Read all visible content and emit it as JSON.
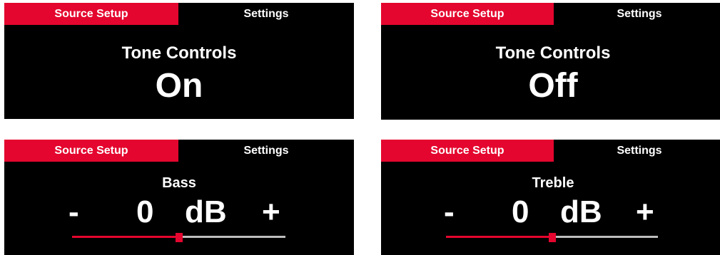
{
  "colors": {
    "accent": "#e4062e",
    "panel_bg": "#000000",
    "text": "#ffffff",
    "slider_track": "#bdbdbd"
  },
  "screens": [
    {
      "tabs": {
        "active": "Source Setup",
        "inactive": "Settings"
      },
      "title": "Tone Controls",
      "value": "On"
    },
    {
      "tabs": {
        "active": "Source Setup",
        "inactive": "Settings"
      },
      "title": "Tone Controls",
      "value": "Off"
    },
    {
      "tabs": {
        "active": "Source Setup",
        "inactive": "Settings"
      },
      "title": "Bass",
      "minus": "-",
      "value": "0",
      "unit": "dB",
      "plus": "+",
      "slider_level": 0.5
    },
    {
      "tabs": {
        "active": "Source Setup",
        "inactive": "Settings"
      },
      "title": "Treble",
      "minus": "-",
      "value": "0",
      "unit": "dB",
      "plus": "+",
      "slider_level": 0.5
    }
  ]
}
